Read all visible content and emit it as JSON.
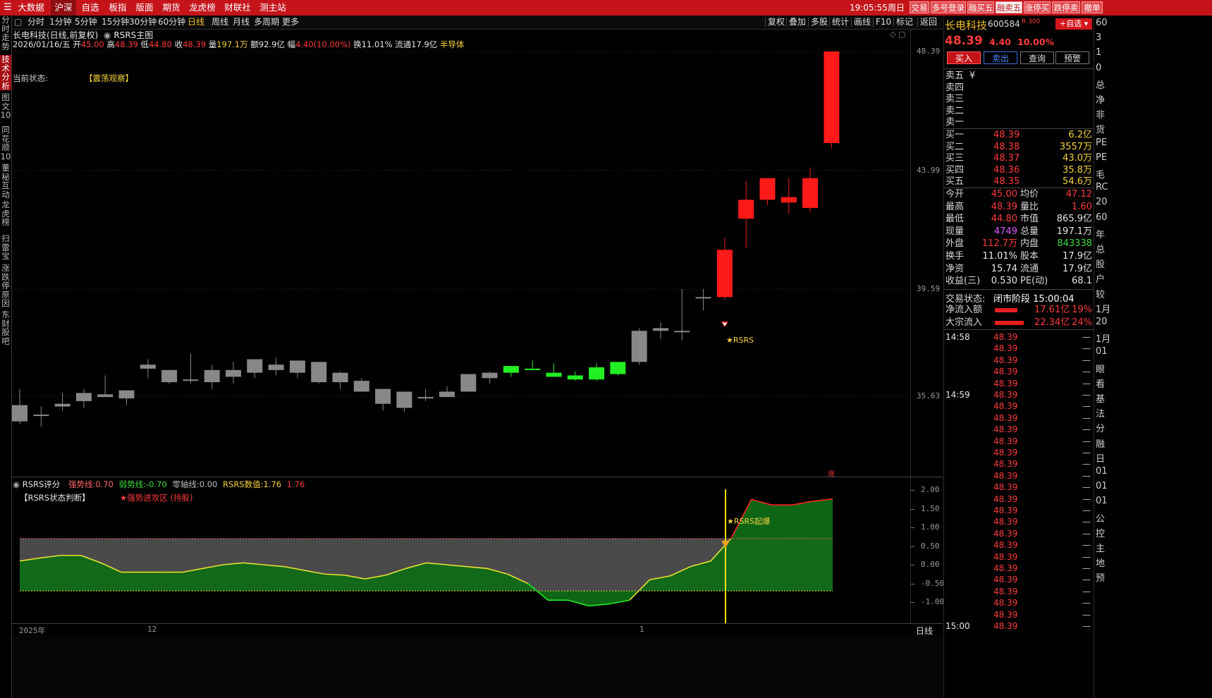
{
  "topbar": {
    "tabs": [
      "大数据",
      "沪深",
      "自选",
      "板指",
      "版面",
      "期货",
      "龙虎榜",
      "财联社",
      "测主站"
    ],
    "active_tab": "沪深",
    "time": "19:05:55",
    "weekday": "周日",
    "right_buttons": [
      "交易",
      "多号登录",
      "融买五",
      "融卖五",
      "涨停买",
      "跌停卖",
      "撤单"
    ],
    "highlight_button": "融卖五"
  },
  "leftnav": {
    "items": [
      "分时走势",
      "技术分析",
      "图文10",
      "同花顺10",
      "董秘互动",
      "龙虎榜",
      "扫雷宝",
      "涨跌停原因",
      "东财股吧"
    ],
    "active": "技术分析"
  },
  "toolbar": {
    "periods": [
      "分时",
      "1分钟",
      "5分钟",
      "15分钟",
      "30分钟",
      "60分钟",
      "日线",
      "周线",
      "月线",
      "多周期",
      "更多"
    ],
    "active_period": "日线",
    "tools": [
      "复权",
      "叠加",
      "多股",
      "统计",
      "画线",
      "F10",
      "标记",
      "返回"
    ]
  },
  "chart_header": {
    "title": "长电科技(日线,前复权)",
    "indicator": "RSRS主图",
    "date": "2026/01/16/五",
    "open_label": "开",
    "open": "45.00",
    "high_label": "高",
    "high": "48.39",
    "low_label": "低",
    "low": "44.80",
    "close_label": "收",
    "close": "48.39",
    "vol_label": "量",
    "vol": "197.1万",
    "amt_label": "额",
    "amt": "92.9亿",
    "chg_label": "幅",
    "chg": "4.40(10.00%)",
    "turn_label": "换",
    "turn": "11.01%",
    "float_label": "流通",
    "float": "17.9亿",
    "sector": "半导体",
    "status_label": "当前状态:",
    "status_value": "【震荡观察】",
    "signal_label": "★RSRS",
    "limit_mark": "涨"
  },
  "price_axis": [
    "48.39",
    "43.99",
    "39.59",
    "35.63"
  ],
  "sub_header": {
    "name": "RSRS评分",
    "strong_label": "强势线:",
    "strong": "0.70",
    "weak_label": "弱势线:",
    "weak": "-0.70",
    "zero_label": "零轴线:",
    "zero": "0.00",
    "value_label": "RSRS数值:",
    "value": "1.76",
    "value2": "1.76",
    "state_title": "【RSRS状态判断】",
    "state_value": "★强势进攻区 (持股)",
    "burst_label": "★RSRS起爆"
  },
  "sub_axis": [
    "2.00",
    "1.50",
    "1.00",
    "0.50",
    "0.00",
    "-0.50",
    "-1.00"
  ],
  "date_axis": [
    "2025年",
    "12",
    "1"
  ],
  "bottom_right": "日线",
  "colors": {
    "up": "#ff1a1a",
    "down": "#22ee22",
    "flat": "#888888",
    "bg": "#000000",
    "brand": "#c4141a"
  },
  "chart_data": {
    "type": "candlestick",
    "title": "长电科技(日线,前复权)",
    "ylim": [
      33.5,
      50.0
    ],
    "candles": [
      {
        "o": 35.3,
        "h": 35.9,
        "l": 34.6,
        "c": 34.7,
        "k": "flat"
      },
      {
        "o": 34.95,
        "h": 35.25,
        "l": 34.5,
        "c": 34.95,
        "k": "flat"
      },
      {
        "o": 35.35,
        "h": 35.75,
        "l": 35.1,
        "c": 35.25,
        "k": "flat"
      },
      {
        "o": 35.45,
        "h": 35.9,
        "l": 35.2,
        "c": 35.75,
        "k": "flat"
      },
      {
        "o": 35.6,
        "h": 36.4,
        "l": 35.6,
        "c": 35.7,
        "k": "flat"
      },
      {
        "o": 35.55,
        "h": 35.85,
        "l": 35.3,
        "c": 35.85,
        "k": "flat"
      },
      {
        "o": 36.8,
        "h": 37.0,
        "l": 36.3,
        "c": 36.65,
        "k": "flat"
      },
      {
        "o": 36.6,
        "h": 36.6,
        "l": 36.1,
        "c": 36.15,
        "k": "flat"
      },
      {
        "o": 36.2,
        "h": 37.2,
        "l": 36.1,
        "c": 36.25,
        "k": "flat"
      },
      {
        "o": 36.6,
        "h": 36.8,
        "l": 35.9,
        "c": 36.15,
        "k": "flat"
      },
      {
        "o": 36.6,
        "h": 36.9,
        "l": 36.1,
        "c": 36.35,
        "k": "flat"
      },
      {
        "o": 36.5,
        "h": 37.0,
        "l": 36.3,
        "c": 37.0,
        "k": "flat"
      },
      {
        "o": 36.8,
        "h": 37.05,
        "l": 36.4,
        "c": 36.6,
        "k": "flat"
      },
      {
        "o": 36.95,
        "h": 36.95,
        "l": 36.3,
        "c": 36.5,
        "k": "flat"
      },
      {
        "o": 36.9,
        "h": 36.9,
        "l": 36.1,
        "c": 36.15,
        "k": "flat"
      },
      {
        "o": 36.5,
        "h": 36.55,
        "l": 35.9,
        "c": 36.15,
        "k": "flat"
      },
      {
        "o": 36.2,
        "h": 36.3,
        "l": 35.8,
        "c": 35.8,
        "k": "flat"
      },
      {
        "o": 35.9,
        "h": 35.9,
        "l": 35.1,
        "c": 35.35,
        "k": "flat"
      },
      {
        "o": 35.8,
        "h": 35.8,
        "l": 35.05,
        "c": 35.2,
        "k": "flat"
      },
      {
        "o": 35.6,
        "h": 35.9,
        "l": 35.45,
        "c": 35.55,
        "k": "flat"
      },
      {
        "o": 35.8,
        "h": 36.0,
        "l": 35.6,
        "c": 35.6,
        "k": "flat"
      },
      {
        "o": 35.8,
        "h": 36.45,
        "l": 35.8,
        "c": 36.45,
        "k": "flat"
      },
      {
        "o": 36.3,
        "h": 36.55,
        "l": 36.1,
        "c": 36.5,
        "k": "flat"
      },
      {
        "o": 36.5,
        "h": 36.7,
        "l": 36.35,
        "c": 36.75,
        "k": "down"
      },
      {
        "o": 36.65,
        "h": 36.95,
        "l": 36.6,
        "c": 36.65,
        "k": "down"
      },
      {
        "o": 36.5,
        "h": 36.85,
        "l": 36.35,
        "c": 36.35,
        "k": "down"
      },
      {
        "o": 36.4,
        "h": 36.55,
        "l": 36.2,
        "c": 36.25,
        "k": "down"
      },
      {
        "o": 36.7,
        "h": 36.85,
        "l": 36.2,
        "c": 36.25,
        "k": "down"
      },
      {
        "o": 36.45,
        "h": 36.9,
        "l": 36.4,
        "c": 36.9,
        "k": "down"
      },
      {
        "o": 36.9,
        "h": 38.15,
        "l": 36.8,
        "c": 38.05,
        "k": "flat"
      },
      {
        "o": 38.15,
        "h": 38.35,
        "l": 37.75,
        "c": 38.05,
        "k": "flat"
      },
      {
        "o": 38.05,
        "h": 39.6,
        "l": 37.7,
        "c": 38.05,
        "k": "flat"
      },
      {
        "o": 39.3,
        "h": 39.6,
        "l": 38.8,
        "c": 39.3,
        "k": "flat"
      },
      {
        "o": 39.3,
        "h": 41.5,
        "l": 39.2,
        "c": 41.05,
        "k": "up"
      },
      {
        "o": 42.2,
        "h": 43.6,
        "l": 41.1,
        "c": 42.9,
        "k": "up"
      },
      {
        "o": 42.9,
        "h": 43.6,
        "l": 42.7,
        "c": 43.7,
        "k": "up"
      },
      {
        "o": 42.8,
        "h": 43.7,
        "l": 42.4,
        "c": 43.0,
        "k": "up"
      },
      {
        "o": 43.7,
        "h": 44.1,
        "l": 42.45,
        "c": 42.6,
        "k": "up"
      },
      {
        "o": 45.0,
        "h": 48.39,
        "l": 44.8,
        "c": 48.39,
        "k": "up"
      }
    ],
    "rsrs": [
      0.1,
      0.18,
      0.25,
      0.25,
      0.05,
      -0.2,
      -0.2,
      -0.2,
      -0.2,
      -0.1,
      0.0,
      0.05,
      0.0,
      -0.05,
      -0.15,
      -0.25,
      -0.28,
      -0.38,
      -0.28,
      -0.1,
      0.05,
      0.0,
      -0.05,
      -0.1,
      -0.25,
      -0.5,
      -0.95,
      -0.95,
      -1.1,
      -1.05,
      -0.95,
      -0.4,
      -0.3,
      -0.05,
      0.1,
      0.7,
      1.75,
      1.6,
      1.6,
      1.7,
      1.76
    ],
    "strong_line": 0.7,
    "weak_line": -0.7
  },
  "quote": {
    "name": "长电科技",
    "code": "600584",
    "r_tag": "R 300",
    "add_btn": "+自选",
    "price": "48.39",
    "chg": "4.40",
    "pct": "10.00%",
    "actions": [
      "买入",
      "卖出",
      "查询",
      "预警"
    ],
    "sells": [
      {
        "k": "卖五",
        "p": "¥",
        "v": ""
      },
      {
        "k": "卖四",
        "p": "",
        "v": ""
      },
      {
        "k": "卖三",
        "p": "",
        "v": ""
      },
      {
        "k": "卖二",
        "p": "",
        "v": ""
      },
      {
        "k": "卖一",
        "p": "",
        "v": ""
      }
    ],
    "buys": [
      {
        "k": "买一",
        "p": "48.39",
        "v": "6.2亿"
      },
      {
        "k": "买二",
        "p": "48.38",
        "v": "3557万"
      },
      {
        "k": "买三",
        "p": "48.37",
        "v": "43.0万"
      },
      {
        "k": "买四",
        "p": "48.36",
        "v": "35.8万"
      },
      {
        "k": "买五",
        "p": "48.35",
        "v": "54.6万"
      }
    ],
    "stats": [
      {
        "k1": "今开",
        "v1": "45.00",
        "c1": "red",
        "k2": "均价",
        "v2": "47.12",
        "c2": "red"
      },
      {
        "k1": "最高",
        "v1": "48.39",
        "c1": "red",
        "k2": "量比",
        "v2": "1.60",
        "c2": "red"
      },
      {
        "k1": "最低",
        "v1": "44.80",
        "c1": "red",
        "k2": "市值",
        "v2": "865.9亿",
        "c2": "wht"
      },
      {
        "k1": "现量",
        "v1": "4749",
        "c1": "mag",
        "k2": "总量",
        "v2": "197.1万",
        "c2": "wht"
      },
      {
        "k1": "外盘",
        "v1": "112.7万",
        "c1": "red",
        "k2": "内盘",
        "v2": "843338",
        "c2": "grn"
      },
      {
        "k1": "换手",
        "v1": "11.01%",
        "c1": "wht",
        "k2": "股本",
        "v2": "17.9亿",
        "c2": "wht"
      },
      {
        "k1": "净资",
        "v1": "15.74",
        "c1": "wht",
        "k2": "流通",
        "v2": "17.9亿",
        "c2": "wht"
      },
      {
        "k1": "收益(三)",
        "v1": "0.530",
        "c1": "wht",
        "k2": "PE(动)",
        "v2": "68.1",
        "c2": "wht"
      }
    ],
    "trade_state_label": "交易状态:",
    "trade_state": "闭市阶段 15:00:04",
    "flows": [
      {
        "k": "净流入额",
        "v": "17.61亿",
        "p": "19%",
        "share": 0.19
      },
      {
        "k": "大宗流入",
        "v": "22.34亿",
        "p": "24%",
        "share": 0.24
      }
    ],
    "ticks": [
      {
        "t": "14:58",
        "p": "48.39"
      },
      {
        "t": "",
        "p": "48.39"
      },
      {
        "t": "",
        "p": "48.39"
      },
      {
        "t": "",
        "p": "48.39"
      },
      {
        "t": "",
        "p": "48.39"
      },
      {
        "t": "14:59",
        "p": "48.39"
      },
      {
        "t": "",
        "p": "48.39"
      },
      {
        "t": "",
        "p": "48.39"
      },
      {
        "t": "",
        "p": "48.39"
      },
      {
        "t": "",
        "p": "48.39"
      },
      {
        "t": "",
        "p": "48.39"
      },
      {
        "t": "",
        "p": "48.39"
      },
      {
        "t": "",
        "p": "48.39"
      },
      {
        "t": "",
        "p": "48.39"
      },
      {
        "t": "",
        "p": "48.39"
      },
      {
        "t": "",
        "p": "48.39"
      },
      {
        "t": "",
        "p": "48.39"
      },
      {
        "t": "",
        "p": "48.39"
      },
      {
        "t": "",
        "p": "48.39"
      },
      {
        "t": "",
        "p": "48.39"
      },
      {
        "t": "",
        "p": "48.39"
      },
      {
        "t": "",
        "p": "48.39"
      },
      {
        "t": "",
        "p": "48.39"
      },
      {
        "t": "",
        "p": "48.39"
      },
      {
        "t": "",
        "p": "48.39"
      },
      {
        "t": "15:00",
        "p": "48.39"
      }
    ]
  },
  "farright": [
    "60",
    "3",
    "1",
    "0",
    "总",
    "净",
    "非",
    "货",
    "PE",
    "PE",
    "毛",
    "RC",
    "20",
    "60",
    "年",
    "总",
    "股",
    "户",
    "较",
    "1月",
    "20",
    "1月",
    "01",
    "眼",
    "看",
    "基",
    "法",
    "分",
    "融",
    "日",
    "01",
    "01",
    "01",
    "公",
    "控",
    "主",
    "地",
    "预"
  ]
}
